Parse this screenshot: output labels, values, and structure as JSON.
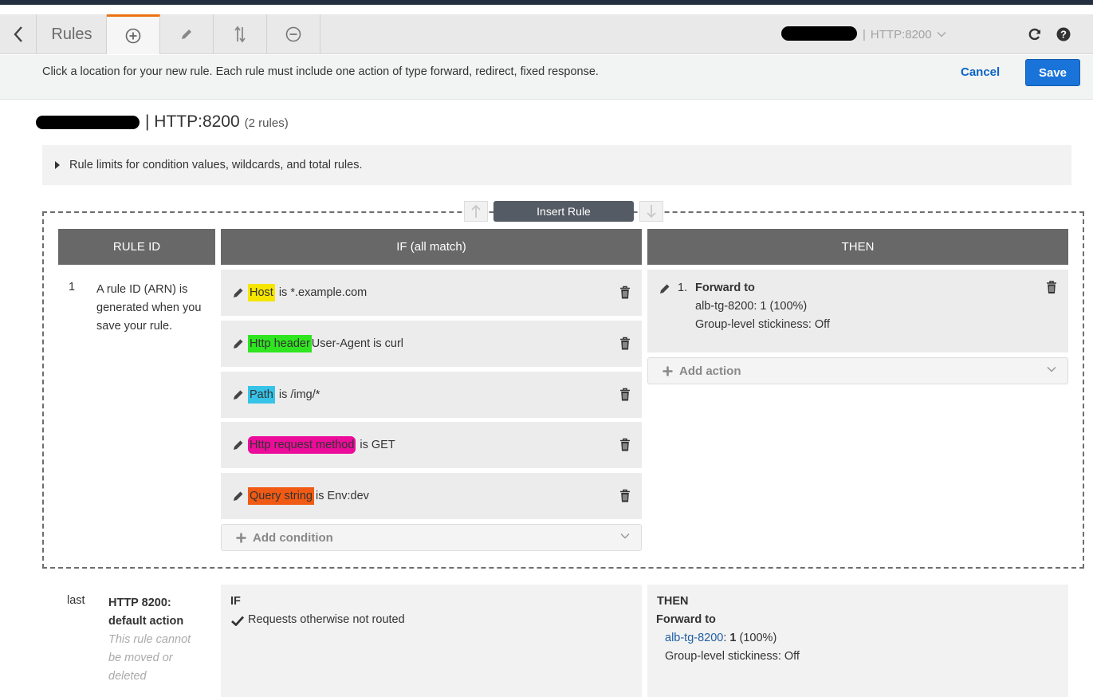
{
  "toolbar": {
    "title": "Rules",
    "listener": "HTTP:8200"
  },
  "info": {
    "message": "Click a location for your new rule. Each rule must include one action of type forward, redirect, fixed response.",
    "cancel_label": "Cancel",
    "save_label": "Save"
  },
  "heading": {
    "listener": "| HTTP:8200",
    "rule_count": "(2 rules)"
  },
  "limits": {
    "label": "Rule limits for condition values, wildcards, and total rules."
  },
  "insert": {
    "label": "Insert Rule"
  },
  "columns": {
    "rule_id": "RULE ID",
    "if": "IF (all match)",
    "then": "THEN"
  },
  "rule1": {
    "number": "1",
    "id_note": "A rule ID (ARN) is generated when you save your rule.",
    "conditions": [
      {
        "field": "Host",
        "value": "is *.example.com",
        "highlight": "#f5e500"
      },
      {
        "field": "Http header",
        "value": "User-Agent is curl",
        "highlight": "#2fe51f"
      },
      {
        "field": "Path",
        "value": "is /img/*",
        "highlight": "#37c3e8"
      },
      {
        "field": "Http request method",
        "value": "is GET",
        "highlight": "#ec0c9a"
      },
      {
        "field": "Query string",
        "value": "is Env:dev",
        "highlight": "#f15a14"
      }
    ],
    "add_condition_label": "Add condition",
    "action": {
      "index": "1.",
      "type": "Forward to",
      "target": "alb-tg-8200: 1 (100%)",
      "stickiness": "Group-level stickiness: Off"
    },
    "add_action_label": "Add action"
  },
  "last_rule": {
    "label": "last",
    "title": "HTTP 8200: default action",
    "note": "This rule cannot be moved or deleted",
    "if_heading": "IF",
    "if_text": "Requests otherwise not routed",
    "then_heading": "THEN",
    "then_type": "Forward to",
    "target_link": "alb-tg-8200",
    "target_sep": ": ",
    "target_weight": "1",
    "target_percent": " (100%)",
    "stickiness": "Group-level stickiness: Off"
  },
  "colors": {
    "accent_tab": "#ec7211",
    "save_button": "#1a73d9",
    "link": "#1f5fa6",
    "header_bg": "#686868"
  }
}
